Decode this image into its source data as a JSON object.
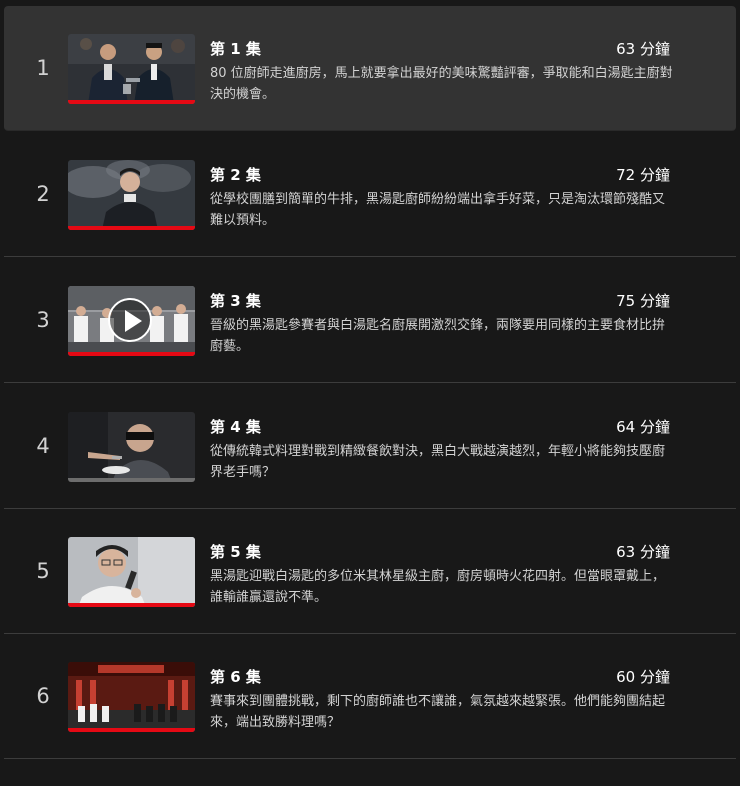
{
  "episodes": [
    {
      "index": "1",
      "title": "第 1 集",
      "duration": "63 分鐘",
      "description": "80 位廚師走進廚房，馬上就要拿出最好的美味驚豔評審，爭取能和白湯匙主廚對決的機會。",
      "progress": 1.0,
      "active": true,
      "thumbnail": "two-chefs-seated"
    },
    {
      "index": "2",
      "title": "第 2 集",
      "duration": "72 分鐘",
      "description": "從學校團膳到簡單的牛排，黑湯匙廚師紛紛端出拿手好菜，只是淘汰環節殘酷又難以預料。",
      "progress": 1.0,
      "active": false,
      "thumbnail": "chef-in-smoke"
    },
    {
      "index": "3",
      "title": "第 3 集",
      "duration": "75 分鐘",
      "description": "晉級的黑湯匙參賽者與白湯匙名廚展開激烈交鋒，兩隊要用同樣的主要食材比拚廚藝。",
      "progress": 1.0,
      "active": false,
      "thumbnail": "chefs-in-white-play-icon"
    },
    {
      "index": "4",
      "title": "第 4 集",
      "duration": "64 分鐘",
      "description": "從傳統韓式料理對戰到精緻餐飲對決，黑白大戰越演越烈，年輕小將能夠技壓廚界老手嗎？",
      "progress": 0.0,
      "active": false,
      "thumbnail": "blindfolded-judge-tasting"
    },
    {
      "index": "5",
      "title": "第 5 集",
      "duration": "63 分鐘",
      "description": "黑湯匙迎戰白湯匙的多位米其林星級主廚，廚房頓時火花四射。但當眼罩戴上，誰輸誰贏還說不準。",
      "progress": 1.0,
      "active": false,
      "thumbnail": "man-with-microphone"
    },
    {
      "index": "6",
      "title": "第 6 集",
      "duration": "60 分鐘",
      "description": "賽事來到團體挑戰，剩下的廚師誰也不讓誰，氣氛越來越緊張。他們能夠團結起來，端出致勝料理嗎？",
      "progress": 1.0,
      "active": false,
      "thumbnail": "team-on-red-stage"
    }
  ],
  "colors": {
    "background": "#181818",
    "active_row": "#333333",
    "progress_fill": "#e50914",
    "progress_track": "#6d6d6d",
    "divider": "#3c3c3c"
  }
}
